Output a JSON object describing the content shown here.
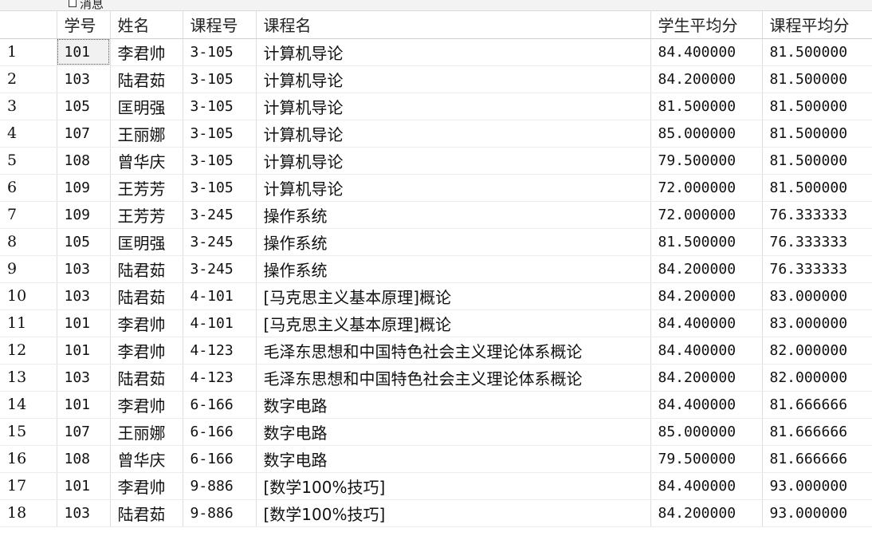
{
  "tab": {
    "label": "消息"
  },
  "columns": [
    "",
    "学号",
    "姓名",
    "课程号",
    "课程名",
    "学生平均分",
    "课程平均分"
  ],
  "rows": [
    {
      "n": "1",
      "sno": "101",
      "name": "李君帅",
      "cno": "3-105",
      "cname": "计算机导论",
      "savg": "84.400000",
      "cavg": "81.500000"
    },
    {
      "n": "2",
      "sno": "103",
      "name": "陆君茹",
      "cno": "3-105",
      "cname": "计算机导论",
      "savg": "84.200000",
      "cavg": "81.500000"
    },
    {
      "n": "3",
      "sno": "105",
      "name": "匡明强",
      "cno": "3-105",
      "cname": "计算机导论",
      "savg": "81.500000",
      "cavg": "81.500000"
    },
    {
      "n": "4",
      "sno": "107",
      "name": "王丽娜",
      "cno": "3-105",
      "cname": "计算机导论",
      "savg": "85.000000",
      "cavg": "81.500000"
    },
    {
      "n": "5",
      "sno": "108",
      "name": "曾华庆",
      "cno": "3-105",
      "cname": "计算机导论",
      "savg": "79.500000",
      "cavg": "81.500000"
    },
    {
      "n": "6",
      "sno": "109",
      "name": "王芳芳",
      "cno": "3-105",
      "cname": "计算机导论",
      "savg": "72.000000",
      "cavg": "81.500000"
    },
    {
      "n": "7",
      "sno": "109",
      "name": "王芳芳",
      "cno": "3-245",
      "cname": "操作系统",
      "savg": "72.000000",
      "cavg": "76.333333"
    },
    {
      "n": "8",
      "sno": "105",
      "name": "匡明强",
      "cno": "3-245",
      "cname": "操作系统",
      "savg": "81.500000",
      "cavg": "76.333333"
    },
    {
      "n": "9",
      "sno": "103",
      "name": "陆君茹",
      "cno": "3-245",
      "cname": "操作系统",
      "savg": "84.200000",
      "cavg": "76.333333"
    },
    {
      "n": "10",
      "sno": "103",
      "name": "陆君茹",
      "cno": "4-101",
      "cname": "[马克思主义基本原理]概论",
      "savg": "84.200000",
      "cavg": "83.000000"
    },
    {
      "n": "11",
      "sno": "101",
      "name": "李君帅",
      "cno": "4-101",
      "cname": "[马克思主义基本原理]概论",
      "savg": "84.400000",
      "cavg": "83.000000"
    },
    {
      "n": "12",
      "sno": "101",
      "name": "李君帅",
      "cno": "4-123",
      "cname": "毛泽东思想和中国特色社会主义理论体系概论",
      "savg": "84.400000",
      "cavg": "82.000000"
    },
    {
      "n": "13",
      "sno": "103",
      "name": "陆君茹",
      "cno": "4-123",
      "cname": "毛泽东思想和中国特色社会主义理论体系概论",
      "savg": "84.200000",
      "cavg": "82.000000"
    },
    {
      "n": "14",
      "sno": "101",
      "name": "李君帅",
      "cno": "6-166",
      "cname": "数字电路",
      "savg": "84.400000",
      "cavg": "81.666666"
    },
    {
      "n": "15",
      "sno": "107",
      "name": "王丽娜",
      "cno": "6-166",
      "cname": "数字电路",
      "savg": "85.000000",
      "cavg": "81.666666"
    },
    {
      "n": "16",
      "sno": "108",
      "name": "曾华庆",
      "cno": "6-166",
      "cname": "数字电路",
      "savg": "79.500000",
      "cavg": "81.666666"
    },
    {
      "n": "17",
      "sno": "101",
      "name": "李君帅",
      "cno": "9-886",
      "cname": "[数学100%技巧]",
      "savg": "84.400000",
      "cavg": "93.000000"
    },
    {
      "n": "18",
      "sno": "103",
      "name": "陆君茹",
      "cno": "9-886",
      "cname": "[数学100%技巧]",
      "savg": "84.200000",
      "cavg": "93.000000"
    }
  ]
}
